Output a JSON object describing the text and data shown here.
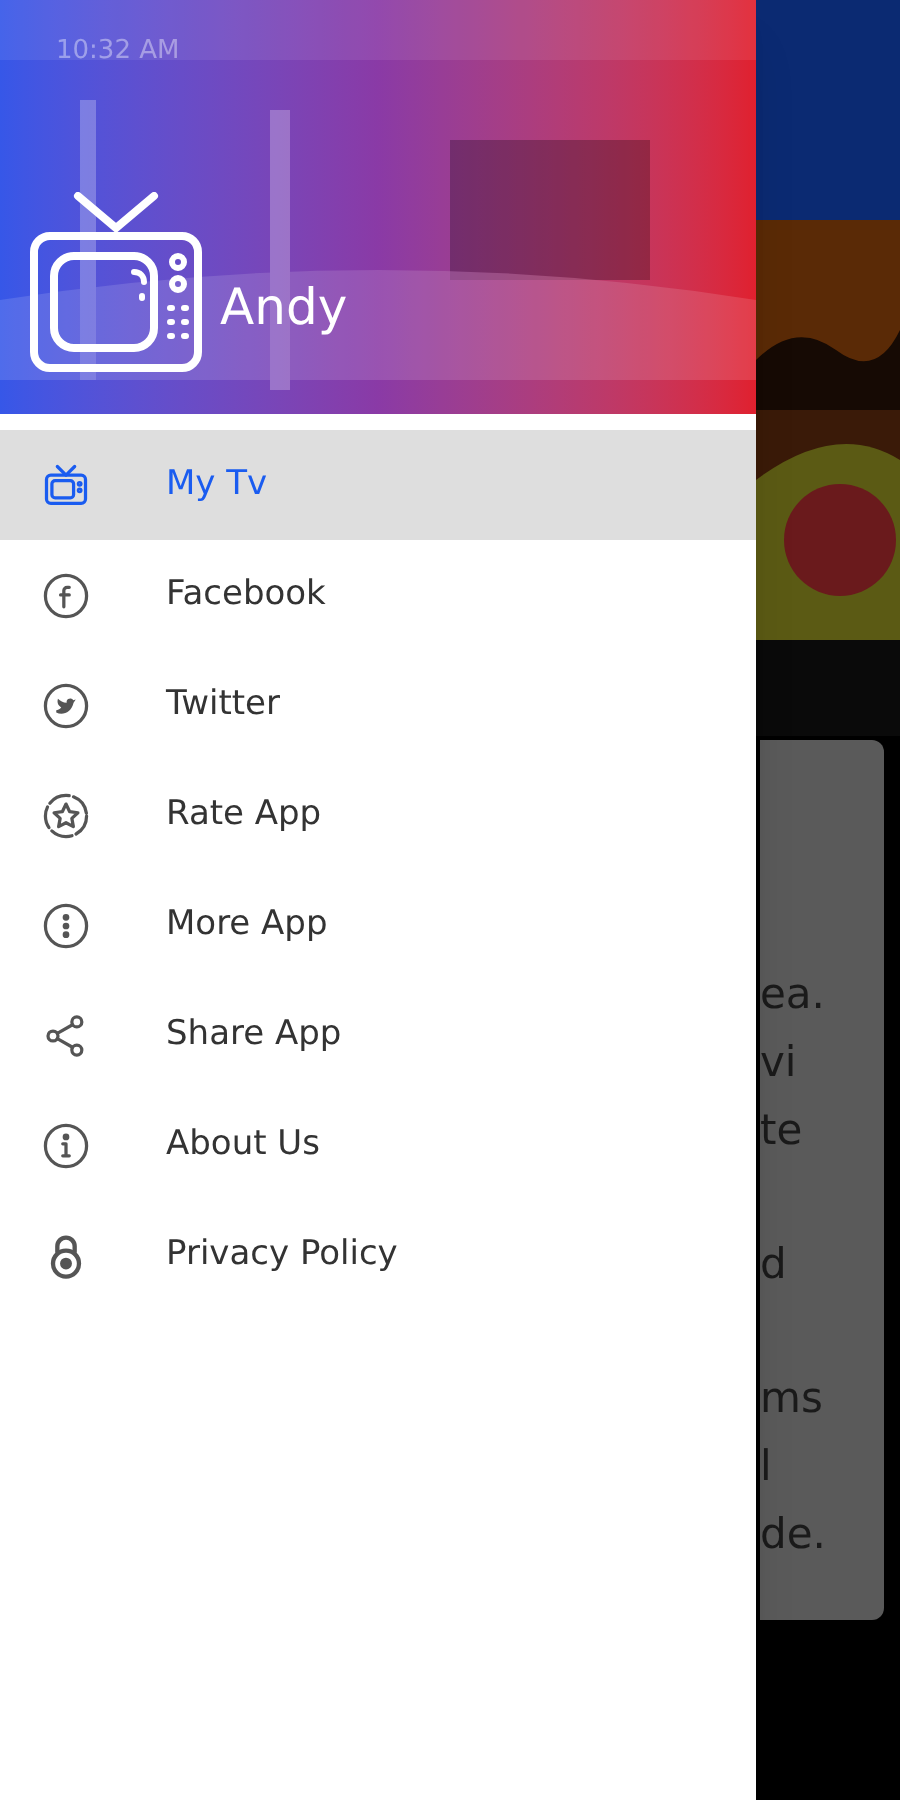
{
  "status_bar": {
    "time": "10:32 AM"
  },
  "drawer": {
    "title": "Andy",
    "items": [
      {
        "label": "My Tv",
        "kind": "tv",
        "selected": true
      },
      {
        "label": "Facebook",
        "kind": "facebook",
        "selected": false
      },
      {
        "label": "Twitter",
        "kind": "twitter",
        "selected": false
      },
      {
        "label": "Rate App",
        "kind": "star",
        "selected": false
      },
      {
        "label": "More App",
        "kind": "more",
        "selected": false
      },
      {
        "label": "Share App",
        "kind": "share",
        "selected": false
      },
      {
        "label": "About Us",
        "kind": "info",
        "selected": false
      },
      {
        "label": "Privacy Policy",
        "kind": "lock",
        "selected": false
      }
    ]
  },
  "background_page": {
    "card_lines": [
      "ea.",
      "vi",
      "te",
      "d",
      "ms",
      "l",
      "de."
    ]
  }
}
